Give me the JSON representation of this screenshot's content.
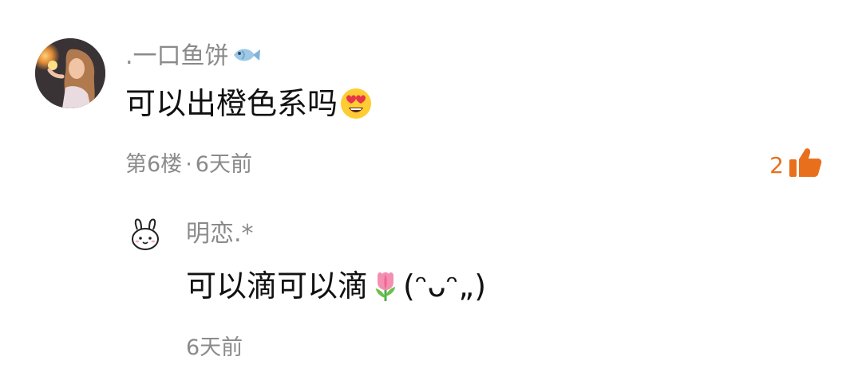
{
  "comment": {
    "username": ".一口鱼饼",
    "username_emoji": "fish-icon",
    "text": "可以出橙色系吗",
    "text_emoji": "heart-eyes-emoji",
    "floor": "第6楼",
    "separator": "·",
    "time": "6天前",
    "like_count": "2",
    "like_icon": "thumbs-up-icon",
    "accent_color": "#e8701c"
  },
  "reply": {
    "username": "明恋.*",
    "text": "可以滴可以滴",
    "text_emoji": "tulip-emoji",
    "text_suffix": "(ᵔᴗᵔ„)",
    "time": "6天前"
  }
}
